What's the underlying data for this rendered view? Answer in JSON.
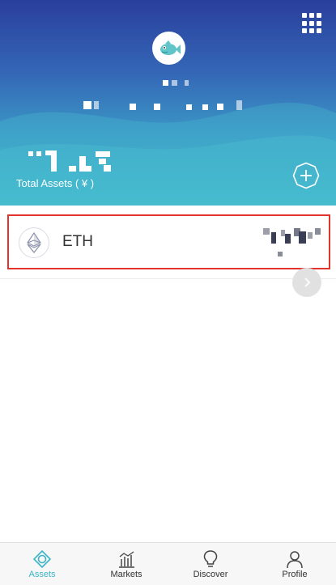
{
  "header": {
    "total_assets_label": "Total Assets ( ¥ )"
  },
  "assets": [
    {
      "symbol": "ETH"
    }
  ],
  "tabbar": {
    "items": [
      {
        "label": "Assets",
        "icon": "diamond-icon",
        "active": true
      },
      {
        "label": "Markets",
        "icon": "chart-icon",
        "active": false
      },
      {
        "label": "Discover",
        "icon": "bulb-icon",
        "active": false
      },
      {
        "label": "Profile",
        "icon": "person-icon",
        "active": false
      }
    ]
  },
  "colors": {
    "accent": "#3ab4c7",
    "highlight_border": "#e2342d",
    "header_top": "#2a3f9c",
    "header_bottom": "#3fb8cc"
  }
}
